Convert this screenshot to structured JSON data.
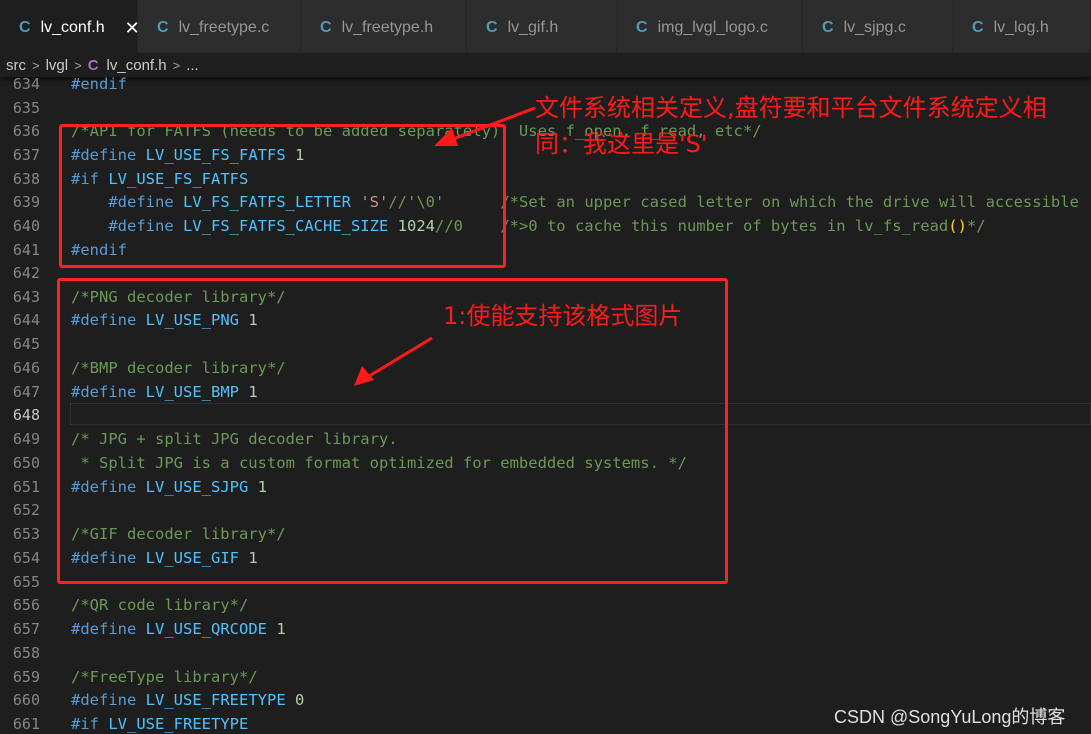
{
  "tabs": [
    {
      "icon": "C",
      "label": "lv_conf.h",
      "close": "✕"
    },
    {
      "icon": "C",
      "label": "lv_freetype.c"
    },
    {
      "icon": "C",
      "label": "lv_freetype.h"
    },
    {
      "icon": "C",
      "label": "lv_gif.h"
    },
    {
      "icon": "C",
      "label": "img_lvgl_logo.c"
    },
    {
      "icon": "C",
      "label": "lv_sjpg.c"
    },
    {
      "icon": "C",
      "label": "lv_log.h"
    }
  ],
  "breadcrumb": {
    "seg1": "src",
    "seg2": "lvgl",
    "icon": "C",
    "file": "lv_conf.h",
    "more": "..."
  },
  "code": {
    "l634": {
      "n": "634",
      "t1": "#endif"
    },
    "l635": {
      "n": "635"
    },
    "l636": {
      "n": "636",
      "t1": "/*API for FATFS (needs to be added separately). Uses f_open, f_read, etc*/"
    },
    "l637": {
      "n": "637",
      "t1": "#define",
      "t2": "LV_USE_FS_FATFS",
      "t3": "1"
    },
    "l638": {
      "n": "638",
      "t1": "#if",
      "t2": "LV_USE_FS_FATFS"
    },
    "l639": {
      "n": "639",
      "t1": "#define",
      "t2": "LV_FS_FATFS_LETTER",
      "t3": "'S'",
      "t4": "//'\\0'",
      "t5": "/*Set an upper cased letter on which the drive will accessible"
    },
    "l640": {
      "n": "640",
      "t1": "#define",
      "t2": "LV_FS_FATFS_CACHE_SIZE",
      "t3": "1024",
      "t4": "//0",
      "t5": "/*>0 to cache this number of bytes in lv_fs_read",
      "t6": "()",
      "t7": "*/"
    },
    "l641": {
      "n": "641",
      "t1": "#endif"
    },
    "l642": {
      "n": "642"
    },
    "l643": {
      "n": "643",
      "t1": "/*PNG decoder library*/"
    },
    "l644": {
      "n": "644",
      "t1": "#define",
      "t2": "LV_USE_PNG",
      "t3": "1"
    },
    "l645": {
      "n": "645"
    },
    "l646": {
      "n": "646",
      "t1": "/*BMP decoder library*/"
    },
    "l647": {
      "n": "647",
      "t1": "#define",
      "t2": "LV_USE_BMP",
      "t3": "1"
    },
    "l648": {
      "n": "648"
    },
    "l649": {
      "n": "649",
      "t1": "/* JPG + split JPG decoder library."
    },
    "l650": {
      "n": "650",
      "t1": " * Split JPG is a custom format optimized for embedded systems. */"
    },
    "l651": {
      "n": "651",
      "t1": "#define",
      "t2": "LV_USE_SJPG",
      "t3": "1"
    },
    "l652": {
      "n": "652"
    },
    "l653": {
      "n": "653",
      "t1": "/*GIF decoder library*/"
    },
    "l654": {
      "n": "654",
      "t1": "#define",
      "t2": "LV_USE_GIF",
      "t3": "1"
    },
    "l655": {
      "n": "655"
    },
    "l656": {
      "n": "656",
      "t1": "/*QR code library*/"
    },
    "l657": {
      "n": "657",
      "t1": "#define",
      "t2": "LV_USE_QRCODE",
      "t3": "1"
    },
    "l658": {
      "n": "658"
    },
    "l659": {
      "n": "659",
      "t1": "/*FreeType library*/"
    },
    "l660": {
      "n": "660",
      "t1": "#define",
      "t2": "LV_USE_FREETYPE",
      "t3": "0"
    },
    "l661": {
      "n": "661",
      "t1": "#if",
      "t2": "LV_USE_FREETYPE"
    }
  },
  "annotations": {
    "fs_line1": "文件系统相关定义,盘符要和平台文件系统定义相",
    "fs_line2": "同：我这里是'S'",
    "decoder": "1:使能支持该格式图片"
  },
  "watermark": "CSDN @SongYuLong的博客",
  "colors": {
    "annotation": "#ff1a1a",
    "keyword": "#569cd6",
    "macro": "#4fc1ff",
    "comment": "#6a9955",
    "number": "#b5cea8",
    "string": "#ce9178"
  }
}
